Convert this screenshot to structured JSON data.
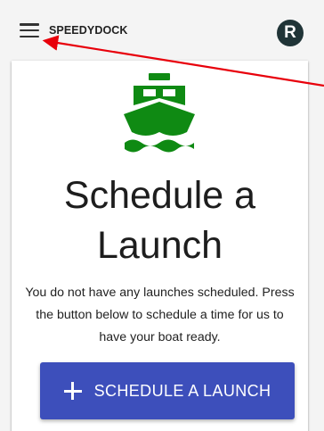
{
  "app": {
    "title": "SPEEDYDOCK",
    "avatar_initial": "R"
  },
  "main": {
    "heading_line1": "Schedule a",
    "heading_line2": "Launch",
    "description": "You do not have any launches scheduled. Press the button below to schedule a time for us to have your boat ready.",
    "cta_label": "SCHEDULE A LAUNCH"
  },
  "icons": {
    "menu": "hamburger-menu-icon",
    "boat": "ferry-boat-icon",
    "plus": "plus-icon"
  },
  "colors": {
    "boat": "#0f8a13",
    "cta_background": "#3d4fbb",
    "avatar_background": "#203437",
    "annotation_arrow": "#e8000b"
  }
}
